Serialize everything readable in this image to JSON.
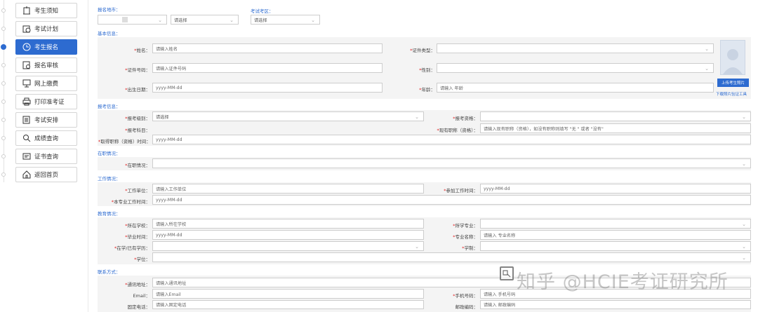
{
  "sidebar": {
    "items": [
      {
        "label": "考生须知",
        "icon": "notice-icon",
        "active": false
      },
      {
        "label": "考试计划",
        "icon": "calendar-icon",
        "active": false
      },
      {
        "label": "考生报名",
        "icon": "clock-icon",
        "active": true
      },
      {
        "label": "报名审核",
        "icon": "review-icon",
        "active": false
      },
      {
        "label": "网上缴费",
        "icon": "monitor-icon",
        "active": false
      },
      {
        "label": "打印准考证",
        "icon": "printer-icon",
        "active": false
      },
      {
        "label": "考试安排",
        "icon": "document-icon",
        "active": false
      },
      {
        "label": "成绩查询",
        "icon": "search-icon",
        "active": false
      },
      {
        "label": "证书查询",
        "icon": "certificate-icon",
        "active": false
      },
      {
        "label": "返回首页",
        "icon": "home-icon",
        "active": false
      }
    ],
    "active_color": "#2d6bd0"
  },
  "top": {
    "city_label": "报名地市：",
    "city_select": "请选择",
    "area_label": "考试考区：",
    "area_select": "请选择"
  },
  "basic": {
    "title": "基本信息：",
    "name_label": "姓名：",
    "name_ph": "请输入姓名",
    "idtype_label": "证件类型：",
    "idno_label": "证件号码：",
    "idno_ph": "请输入证件号码",
    "gender_label": "性别：",
    "birth_label": "出生日期：",
    "birth_ph": "yyyy-MM-dd",
    "age_label": "年龄：",
    "age_ph": "请输入 年龄",
    "upload_btn": "上传考生照片",
    "download_link": "下载照片验证工具"
  },
  "exam": {
    "title": "报考信息：",
    "level_label": "报考级别：",
    "level_select": "请选择",
    "qual_label": "报考资格：",
    "subject_label": "报考科目：",
    "title_label": "现有职称（资格）：",
    "title_ph": "请输入现有职称（资格），如没有职称则填写 \"无 \" 或者 \"没有\"",
    "titletime_label": "取得职称（资格）时间：",
    "titletime_ph": "yyyy-MM-dd"
  },
  "job": {
    "title": "在职情况：",
    "status_label": "在职情况："
  },
  "work": {
    "title": "工作情况：",
    "unit_label": "工作单位：",
    "unit_ph": "请输入工作单位",
    "start_label": "参加工作时间：",
    "start_ph": "yyyy-MM-dd",
    "prof_label": "本专业工作时间：",
    "prof_ph": "yyyy-MM-dd"
  },
  "edu": {
    "title": "教育情况：",
    "school_label": "所在学校：",
    "school_ph": "请输入所在学校",
    "major_label": "所学专业：",
    "grad_label": "毕业时间：",
    "grad_ph": "yyyy-MM-dd",
    "majorname_label": "专业名称：",
    "majorname_ph": "请输入 专业名称",
    "degree_label": "在学/已有学历：",
    "system_label": "学制：",
    "diploma_label": "学位："
  },
  "contact": {
    "title": "联系方式：",
    "addr_label": "通讯地址：",
    "addr_ph": "请输入通讯地址",
    "email_label": "Email：",
    "email_ph": "请输入Email",
    "mobile_label": "手机号码：",
    "mobile_ph": "请输入 手机号码",
    "phone_label": "固定电话：",
    "phone_ph": "请输入固定电话",
    "zip_label": "邮政编码：",
    "zip_ph": "请输入 邮政编码"
  },
  "watermark": "知乎 @HCIE考证研究所"
}
